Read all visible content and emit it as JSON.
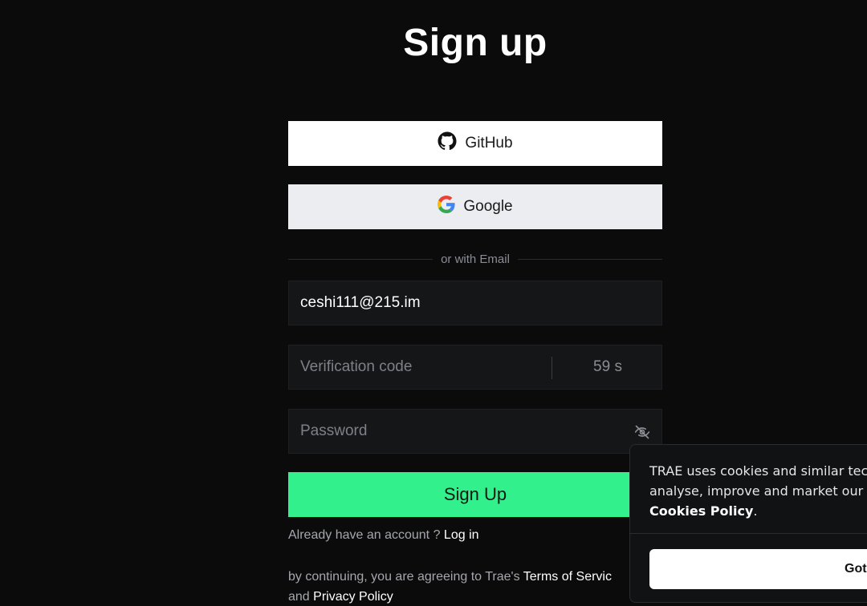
{
  "title": "Sign up",
  "github_label": "GitHub",
  "google_label": "Google",
  "divider_text": "or with Email",
  "email_value": "ceshi111@215.im",
  "code_placeholder": "Verification code",
  "countdown": "59 s",
  "password_placeholder": "Password",
  "signup_label": "Sign Up",
  "already_text": "Already have an account ?",
  "login_link": "Log in",
  "legal_prefix": "by continuing, you are agreeing to Trae's",
  "terms_link": "Terms of Servic",
  "legal_and": "and",
  "privacy_link": "Privacy Policy",
  "cookie": {
    "line1": "TRAE uses cookies and similar tech",
    "line2": "analyse, improve and market our se",
    "policy_link": "Cookies Policy",
    "policy_suffix": ".",
    "button_label": "Got"
  },
  "colors": {
    "background": "#0b0b0c",
    "signup_accent": "#32f08c",
    "field_bg": "#151618"
  },
  "icons": {
    "github": "github-icon",
    "google": "google-icon",
    "eye": "eye-off-icon"
  }
}
